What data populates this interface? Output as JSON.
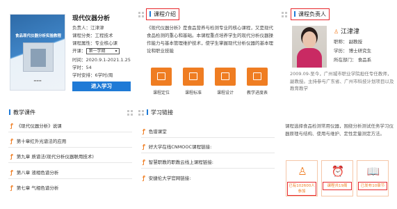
{
  "course": {
    "title": "现代仪器分析",
    "cover_title": "食品现代仪器分析实验教程",
    "owner_label": "负责人：江津津",
    "category": "课程分类：工程技术",
    "attribute": "课程属性：专业核心课",
    "term_label": "开课：",
    "term_value": "第一学期",
    "time": "时间：2020.9.1-2021.1.25",
    "hours": "学时：54",
    "weekly_hours": "学时安排：6学时/周",
    "study_button": "进入学习"
  },
  "intro": {
    "heading": "课程介绍",
    "text": "《现代仪器分析》是食品营养与检测专业的核心课程，又是现代食品检测的重心和基础。本课程重点培养学生的现代分析仪器操作能力与基本管理维护技术，使学生掌握现代分析仪器的基本理论和职业技能",
    "tiles": [
      {
        "label": "课程定位",
        "icon": "doc-icon"
      },
      {
        "label": "课程标准",
        "icon": "list-icon"
      },
      {
        "label": "课程设计",
        "icon": "design-icon"
      },
      {
        "label": "教学进度表",
        "icon": "calendar-icon"
      }
    ]
  },
  "teacher": {
    "heading": "课程负责人",
    "name": "江津津",
    "title": "职称：  副教授",
    "degree": "学历：  博士研究生",
    "department": "所在部门：  食品系",
    "bio": "2009.09-至今，广州城市职业学院担任专任教师，副教授。主持参与广东省、广州市科技计划项目以及教育教学"
  },
  "courseware": {
    "heading": "教学课件",
    "items": [
      "《现代仪器分析》说课",
      "第十章红外光谱法的应用",
      "第九章 质谱法(现代分析仪器联用技术)",
      "第八章 液相色谱分析",
      "第七章 气相色谱分析"
    ]
  },
  "links": {
    "heading": "学习链接",
    "items": [
      "色谱课堂",
      "好大学在线CNMOOC课程链接:",
      "智慧职教的职教云线上课程链接:",
      "安捷伦大学官网链接:"
    ]
  },
  "summary": {
    "text": "课程选择食品检测常用仪器，围绕分析测试任务学习仪器原理与结构、使用与维护、定性定量测定方法。",
    "stats": [
      {
        "label": "已有102600人参加",
        "icon": "person-icon"
      },
      {
        "label": "课程共19周",
        "icon": "clock-icon"
      },
      {
        "label": "已发布10章节",
        "icon": "book-icon"
      }
    ]
  }
}
